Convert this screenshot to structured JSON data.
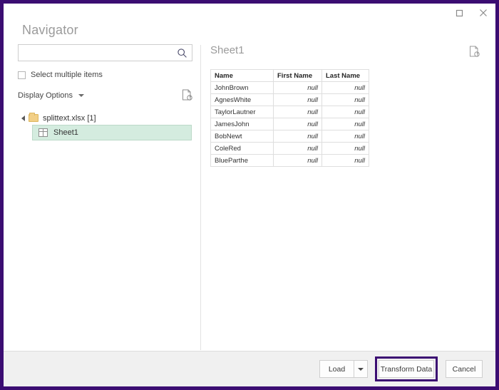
{
  "window": {
    "title": "Navigator",
    "controls": [
      {
        "name": "maximize",
        "icon": "maximize-icon"
      },
      {
        "name": "close",
        "icon": "close-icon"
      }
    ]
  },
  "left_pane": {
    "search": {
      "value": "",
      "placeholder": "",
      "icon": "search-icon"
    },
    "select_multiple": {
      "label": "Select multiple items",
      "checked": false
    },
    "display_options": {
      "label": "Display Options",
      "caret": "chevron-down-icon"
    },
    "refresh_icon": "refresh-page-icon",
    "tree": {
      "root": {
        "label": "splittext.xlsx [1]",
        "expanded": true,
        "icon": "folder-icon"
      },
      "children": [
        {
          "label": "Sheet1",
          "icon": "worksheet-icon",
          "selected": true
        }
      ]
    }
  },
  "right_pane": {
    "title": "Sheet1",
    "refresh_icon": "refresh-page-icon",
    "table": {
      "columns": [
        "Name",
        "First Name",
        "Last Name"
      ],
      "rows": [
        [
          "JohnBrown",
          "null",
          "null"
        ],
        [
          "AgnesWhite",
          "null",
          "null"
        ],
        [
          "TaylorLautner",
          "null",
          "null"
        ],
        [
          "JamesJohn",
          "null",
          "null"
        ],
        [
          "BobNewt",
          "null",
          "null"
        ],
        [
          "ColeRed",
          "null",
          "null"
        ],
        [
          "BlueParthe",
          "null",
          "null"
        ]
      ]
    }
  },
  "footer": {
    "load_label": "Load",
    "load_dropdown_icon": "chevron-down-icon",
    "transform_label": "Transform Data",
    "cancel_label": "Cancel",
    "highlight_color": "#3b0d72"
  }
}
